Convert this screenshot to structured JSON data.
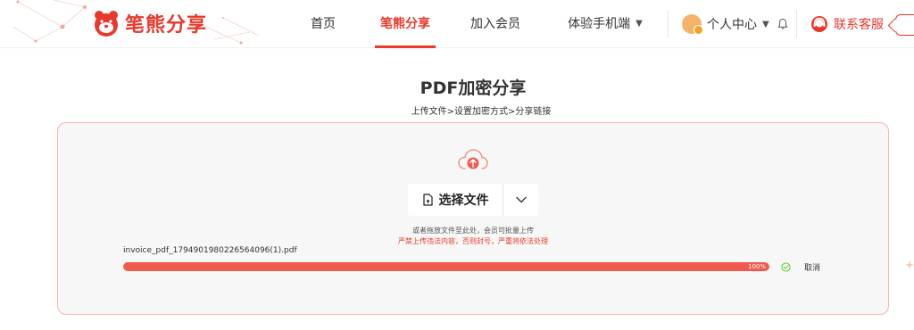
{
  "brand": {
    "name": "笔熊分享",
    "color": "#e8392b"
  },
  "nav": {
    "items": [
      {
        "label": "首页"
      },
      {
        "label": "笔熊分享",
        "active": true
      },
      {
        "label": "加入会员"
      },
      {
        "label": "体验手机端"
      }
    ],
    "user_center": "个人中心",
    "service": "联系客服"
  },
  "page": {
    "title": "PDF加密分享",
    "steps": "上传文件>设置加密方式>分享链接"
  },
  "upload": {
    "select_label": "选择文件",
    "hint": "或者拖放文件至此处，会员可批量上传",
    "warning": "严禁上传违法内容，否则封号，严重将依法处理",
    "file": {
      "name": "invoice_pdf_1794901980226564096(1).pdf",
      "progress": 1.0,
      "progress_text": "100%",
      "cancel_label": "取消"
    }
  },
  "icons": [
    "logo-bear-icon",
    "chevron-down-icon",
    "bell-icon",
    "headset-icon",
    "cloud-upload-icon",
    "file-icon",
    "check-circle-icon",
    "sparkle-icon"
  ]
}
